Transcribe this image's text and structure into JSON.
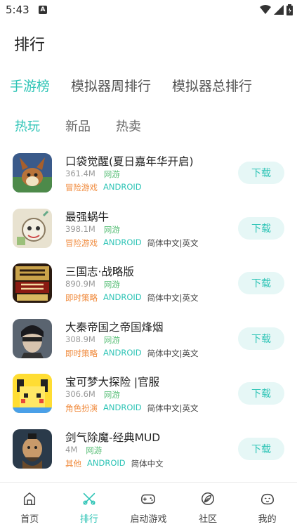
{
  "status_bar": {
    "time": "5:43",
    "notif_letter": "A"
  },
  "header": {
    "title": "排行"
  },
  "top_tabs": [
    {
      "label": "手游榜",
      "active": true
    },
    {
      "label": "模拟器周排行",
      "active": false
    },
    {
      "label": "模拟器总排行",
      "active": false
    }
  ],
  "sub_tabs": [
    {
      "label": "热玩",
      "active": true
    },
    {
      "label": "新品",
      "active": false
    },
    {
      "label": "热卖",
      "active": false
    }
  ],
  "download_label": "下载",
  "games": [
    {
      "name": "口袋觉醒(夏日嘉年华开启)",
      "size": "361.4M",
      "network": "网游",
      "category": "冒险游戏",
      "platform": "ANDROID",
      "lang": ""
    },
    {
      "name": "最强蜗牛",
      "size": "398.1M",
      "network": "网游",
      "category": "冒险游戏",
      "platform": "ANDROID",
      "lang": "简体中文|英文"
    },
    {
      "name": "三国志·战略版",
      "size": "890.9M",
      "network": "网游",
      "category": "即时策略",
      "platform": "ANDROID",
      "lang": "简体中文|英文"
    },
    {
      "name": "大秦帝国之帝国烽烟",
      "size": "308.9M",
      "network": "网游",
      "category": "即时策略",
      "platform": "ANDROID",
      "lang": "简体中文|英文"
    },
    {
      "name": "宝可梦大探险 |官服",
      "size": "306.6M",
      "network": "网游",
      "category": "角色扮演",
      "platform": "ANDROID",
      "lang": "简体中文|英文"
    },
    {
      "name": "剑气除魔-经典MUD",
      "size": "4M",
      "network": "网游",
      "category": "其他",
      "platform": "ANDROID",
      "lang": "简体中文"
    }
  ],
  "bottom_nav": [
    {
      "label": "首页",
      "icon": "home-icon",
      "active": false
    },
    {
      "label": "排行",
      "icon": "ranking-icon",
      "active": true
    },
    {
      "label": "启动游戏",
      "icon": "gamepad-icon",
      "active": false
    },
    {
      "label": "社区",
      "icon": "community-icon",
      "active": false
    },
    {
      "label": "我的",
      "icon": "profile-icon",
      "active": false
    }
  ],
  "colors": {
    "accent": "#2ec4b6",
    "category": "#f08a3c",
    "network": "#5cc07a"
  }
}
